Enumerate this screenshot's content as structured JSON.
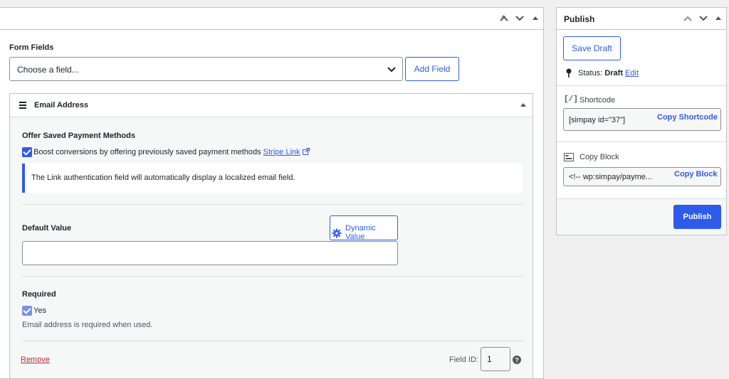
{
  "main": {
    "form_fields_label": "Form Fields",
    "choose_field_placeholder": "Choose a field...",
    "add_field_label": "Add Field",
    "field_panel": {
      "title": "Email Address",
      "offer_saved_title": "Offer Saved Payment Methods",
      "boost_text": "Boost conversions by offering previously saved payment methods",
      "stripe_link_label": "Stripe Link",
      "notice_text": "The Link authentication field will automatically display a localized email field.",
      "default_value_label": "Default Value",
      "dynamic_value_label": "Dynamic Value",
      "default_value": "",
      "required_label": "Required",
      "yes_label": "Yes",
      "required_help": "Email address is required when used.",
      "remove_label": "Remove",
      "field_id_label": "Field ID:",
      "field_id_value": "1"
    }
  },
  "publish": {
    "title": "Publish",
    "save_draft_label": "Save Draft",
    "status_label": "Status:",
    "status_value": "Draft",
    "edit_label": "Edit",
    "shortcode_icon_text": "[/]",
    "shortcode_label": "Shortcode",
    "shortcode_value": "[simpay id=\"37\"]",
    "copy_shortcode_label": "Copy Shortcode",
    "copy_block_label": "Copy Block",
    "block_value": "<!-- wp:simpay/payme...",
    "copy_block_button_label": "Copy Block",
    "publish_button_label": "Publish"
  },
  "colors": {
    "accent": "#2f5bea",
    "remove": "#b32d2e",
    "background": "#f0f0f1"
  }
}
